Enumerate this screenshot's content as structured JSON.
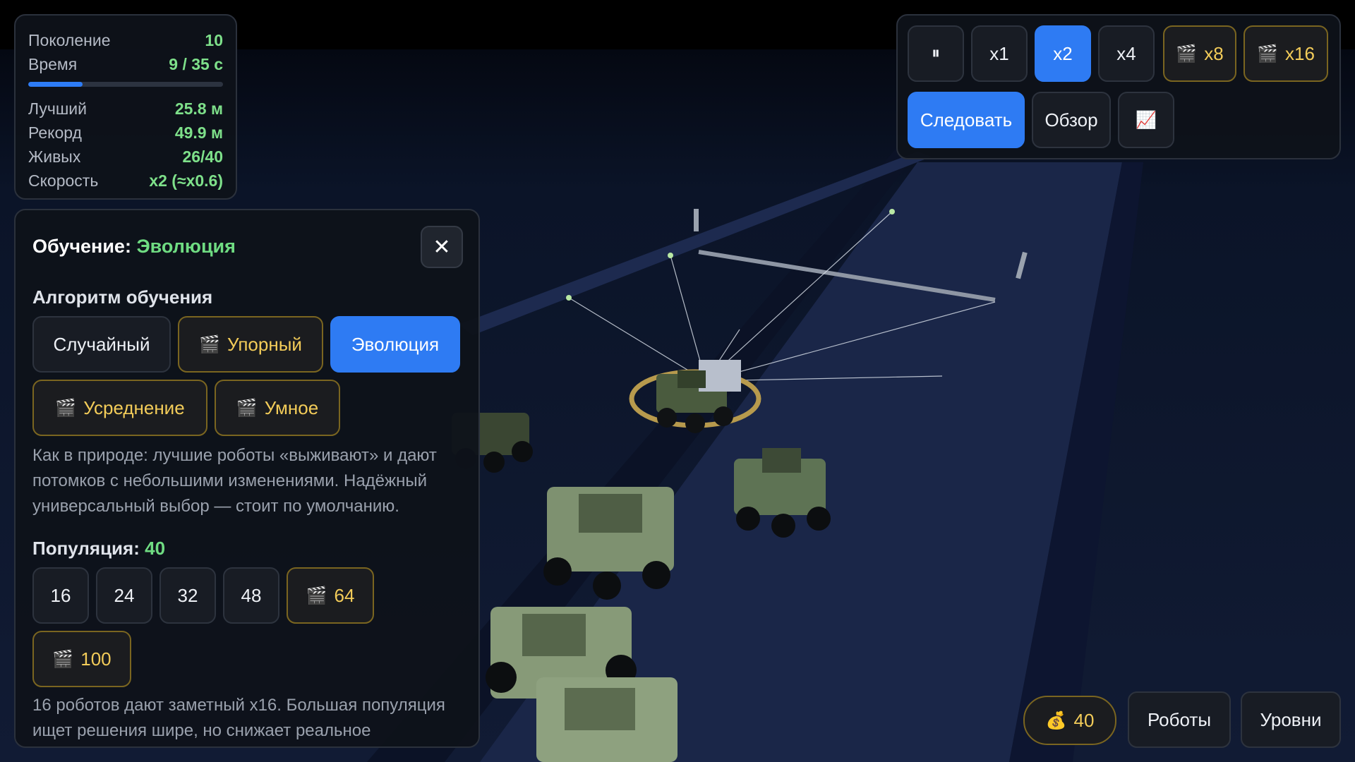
{
  "stats": [
    {
      "label": "Поколение",
      "value": "10"
    },
    {
      "label": "Время",
      "value": "9 / 35 с"
    },
    {
      "label": "Лучший",
      "value": "25.8 м"
    },
    {
      "label": "Рекорд",
      "value": "49.9 м"
    },
    {
      "label": "Живых",
      "value": "26/40"
    },
    {
      "label": "Скорость",
      "value": "x2 (≈x0.6)"
    }
  ],
  "time_progress": 0.28,
  "controls": {
    "pause_glyph": "⏸",
    "x1": "x1",
    "x2": "x2",
    "x4": "x4",
    "x8": "x8",
    "x16": "x16",
    "follow": "Следовать",
    "overview": "Обзор",
    "chart_glyph": "📈",
    "clapper_glyph": "🎬"
  },
  "training": {
    "title_prefix": "Обучение:",
    "title_value": "Эволюция",
    "close_glyph": "✕",
    "algorithm_heading": "Алгоритм обучения",
    "algorithms": {
      "random": "Случайный",
      "stubborn": "Упорный",
      "evolution": "Эволюция",
      "averaging": "Усреднение",
      "smart": "Умное"
    },
    "description": "Как в природе: лучшие роботы «выживают» и дают потомков с небольшими изменениями. Надёжный универсальный выбор — стоит по умолчанию.",
    "population_label": "Популяция:",
    "population_value": "40",
    "population_options": {
      "p16": "16",
      "p24": "24",
      "p32": "32",
      "p48": "48",
      "p64": "64",
      "p100": "100"
    },
    "population_note": "16 роботов дают заметный x16. Большая популяция ищет решения шире, но снижает реальное"
  },
  "bottom": {
    "coin_glyph": "💰",
    "coins": "40",
    "robots": "Роботы",
    "levels": "Уровни"
  },
  "colors": {
    "accent_blue": "#2e7bf3",
    "accent_green": "#6fdc82",
    "gold": "#f3cc59",
    "background": "#0a0f1e"
  }
}
